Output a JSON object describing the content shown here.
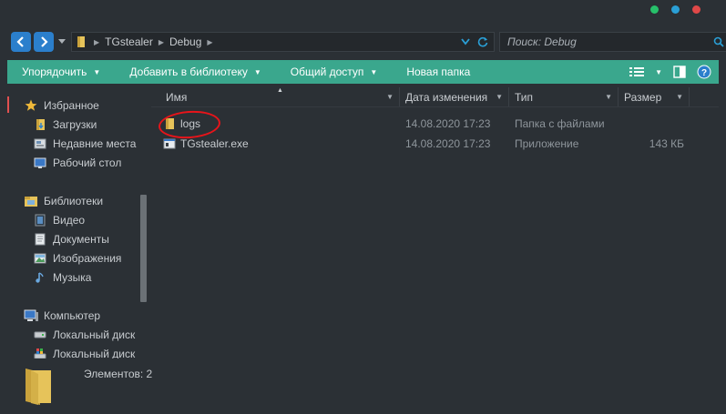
{
  "window": {
    "controls": [
      {
        "name": "minimize-dot",
        "color": "#27c06a"
      },
      {
        "name": "maximize-dot",
        "color": "#2a9fd6"
      },
      {
        "name": "close-dot",
        "color": "#e04848"
      }
    ]
  },
  "address": {
    "crumbs": [
      "TGstealer",
      "Debug"
    ]
  },
  "search": {
    "placeholder": "Поиск: Debug"
  },
  "toolbar": {
    "organize": "Упорядочить",
    "add_library": "Добавить в библиотеку",
    "share": "Общий доступ",
    "new_folder": "Новая папка"
  },
  "sidebar": {
    "favorites": "Избранное",
    "downloads": "Загрузки",
    "recent": "Недавние места",
    "desktop": "Рабочий стол",
    "libraries": "Библиотеки",
    "video": "Видео",
    "documents": "Документы",
    "images": "Изображения",
    "music": "Музыка",
    "computer": "Компьютер",
    "disk1": "Локальный диск",
    "disk2": "Локальный диск"
  },
  "columns": {
    "name": "Имя",
    "date": "Дата изменения",
    "type": "Тип",
    "size": "Размер"
  },
  "files": [
    {
      "name": "logs",
      "date": "14.08.2020 17:23",
      "type": "Папка с файлами",
      "size": "",
      "icon": "folder-icon"
    },
    {
      "name": "TGstealer.exe",
      "date": "14.08.2020 17:23",
      "type": "Приложение",
      "size": "143 КБ",
      "icon": "exe-icon"
    }
  ],
  "status": {
    "count_text": "Элементов: 2"
  },
  "colors": {
    "toolbar": "#3aa78d",
    "nav_button": "#2b7fcc",
    "highlight": "#e8141a",
    "background": "#2b3035"
  }
}
